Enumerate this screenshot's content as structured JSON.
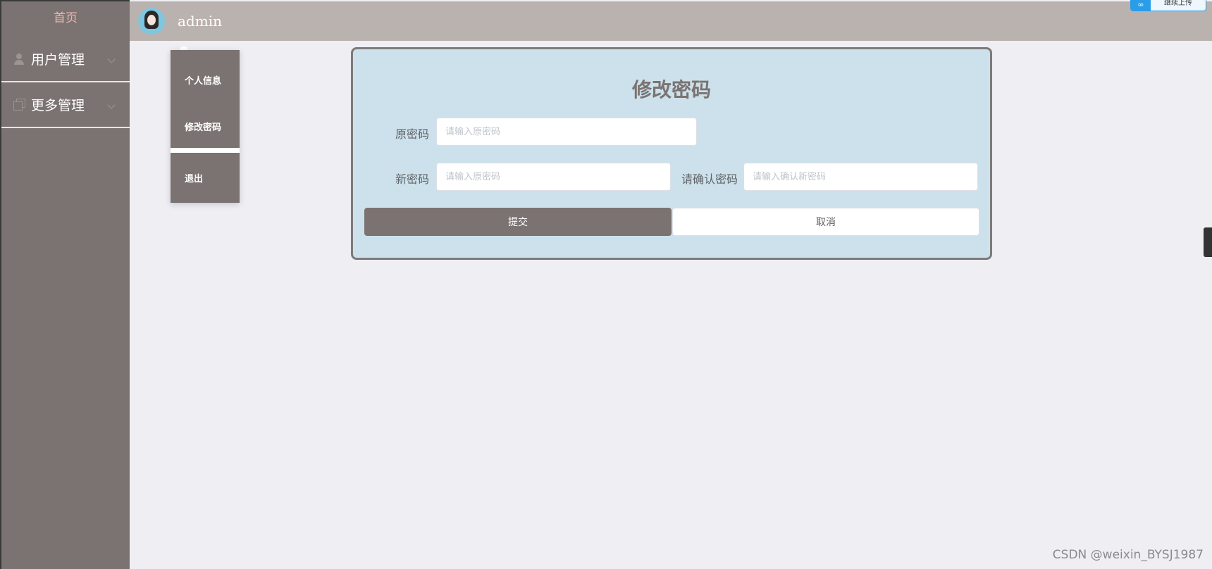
{
  "sidebar": {
    "home_label": "首页",
    "items": [
      {
        "label": "用户管理",
        "icon": "user-icon"
      },
      {
        "label": "更多管理",
        "icon": "copy-icon"
      }
    ]
  },
  "header": {
    "username": "admin"
  },
  "badge": {
    "icon": "∞",
    "text": "继续上传"
  },
  "dropdown": {
    "items": [
      {
        "label": "个人信息"
      },
      {
        "label": "修改密码"
      },
      {
        "label": "退出"
      }
    ]
  },
  "form": {
    "title": "修改密码",
    "old_password": {
      "label": "原密码",
      "placeholder": "请输入原密码",
      "value": ""
    },
    "new_password": {
      "label": "新密码",
      "placeholder": "请输入原密码",
      "value": ""
    },
    "confirm_password": {
      "label": "请确认密码",
      "placeholder": "请输入确认新密码",
      "value": ""
    },
    "submit_label": "提交",
    "cancel_label": "取消"
  },
  "watermark": "CSDN @weixin_BYSJ1987",
  "colors": {
    "sidebar_bg": "#7b7371",
    "header_bg": "#bab2ae",
    "card_bg": "#cce1eb",
    "accent": "#7b7371"
  }
}
